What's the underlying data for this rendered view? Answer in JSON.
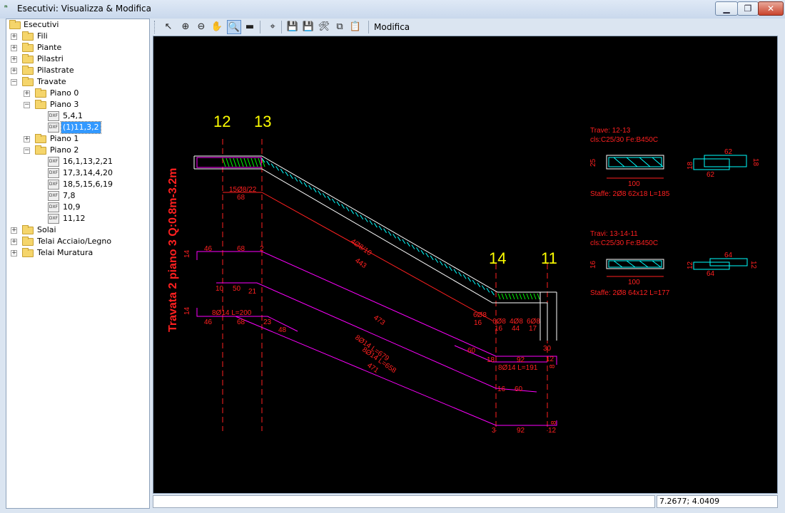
{
  "window": {
    "title": "Esecutivi: Visualizza & Modifica",
    "minimize": "▁",
    "maximize": "❐",
    "close": "✕"
  },
  "tree": {
    "root": "Esecutivi",
    "nodes": [
      {
        "label": "Fili",
        "depth": 1,
        "expander": "+",
        "type": "folder"
      },
      {
        "label": "Piante",
        "depth": 1,
        "expander": "+",
        "type": "folder"
      },
      {
        "label": "Pilastri",
        "depth": 1,
        "expander": "+",
        "type": "folder"
      },
      {
        "label": "Pilastrate",
        "depth": 1,
        "expander": "+",
        "type": "folder"
      },
      {
        "label": "Travate",
        "depth": 1,
        "expander": "−",
        "type": "folder"
      },
      {
        "label": "Piano 0",
        "depth": 2,
        "expander": "+",
        "type": "folder"
      },
      {
        "label": "Piano 3",
        "depth": 2,
        "expander": "−",
        "type": "folder"
      },
      {
        "label": "5,4,1",
        "depth": 3,
        "expander": "",
        "type": "dxf"
      },
      {
        "label": "(1)11,3,2",
        "depth": 3,
        "expander": "",
        "type": "dxf",
        "selected": true
      },
      {
        "label": "Piano 1",
        "depth": 2,
        "expander": "+",
        "type": "folder"
      },
      {
        "label": "Piano 2",
        "depth": 2,
        "expander": "−",
        "type": "folder"
      },
      {
        "label": "16,1,13,2,21",
        "depth": 3,
        "expander": "",
        "type": "dxf"
      },
      {
        "label": "17,3,14,4,20",
        "depth": 3,
        "expander": "",
        "type": "dxf"
      },
      {
        "label": "18,5,15,6,19",
        "depth": 3,
        "expander": "",
        "type": "dxf"
      },
      {
        "label": "7,8",
        "depth": 3,
        "expander": "",
        "type": "dxf"
      },
      {
        "label": "10,9",
        "depth": 3,
        "expander": "",
        "type": "dxf"
      },
      {
        "label": "11,12",
        "depth": 3,
        "expander": "",
        "type": "dxf"
      },
      {
        "label": "Solai",
        "depth": 1,
        "expander": "+",
        "type": "folder"
      },
      {
        "label": "Telai Acciaio/Legno",
        "depth": 1,
        "expander": "+",
        "type": "folder"
      },
      {
        "label": "Telai Muratura",
        "depth": 1,
        "expander": "+",
        "type": "folder"
      }
    ],
    "dxf_icon_text": "DXF"
  },
  "toolbar": {
    "buttons": [
      {
        "name": "select-pointer-button",
        "glyph": "↖"
      },
      {
        "name": "zoom-in-button",
        "glyph": "⊕"
      },
      {
        "name": "zoom-out-button",
        "glyph": "⊖"
      },
      {
        "name": "pan-hand-button",
        "glyph": "✋"
      },
      {
        "name": "zoom-window-button",
        "glyph": "🔍",
        "active": true
      },
      {
        "name": "measure-ruler-button",
        "glyph": "▬"
      },
      {
        "name": "zoom-extents-button",
        "glyph": "⌖"
      },
      {
        "name": "save-button",
        "glyph": "💾"
      },
      {
        "name": "save-as-button",
        "glyph": "💾"
      },
      {
        "name": "settings-tools-button",
        "glyph": "🛠"
      },
      {
        "name": "copy-button",
        "glyph": "⧉"
      },
      {
        "name": "paste-button",
        "glyph": "📋"
      }
    ],
    "modifica_label": "Modifica"
  },
  "drawing": {
    "colors": {
      "background": "#000000",
      "axis_labels": "#ffff00",
      "rebar": "#ff00ff",
      "dimensions": "#ff2020",
      "beam_outline": "#ffffff",
      "hatch": "#00ffff",
      "green": "#00ff00"
    },
    "axis_labels": [
      "12",
      "13",
      "14",
      "11"
    ],
    "vertical_title": "Travata 2 piano 3 Q:0.8m-3.2m",
    "dimension_texts": [
      "15Ø8/22",
      "68",
      "4Ø8/10",
      "443",
      "46",
      "68",
      "2",
      "14",
      "10",
      "50",
      "21",
      "8Ø14  L=200",
      "14",
      "46",
      "68",
      "23",
      "48",
      "473",
      "8Ø14  L=679",
      "8Ø14  L=658",
      "471",
      "6Ø8",
      "4Ø8",
      "6Ø8",
      "16",
      "44",
      "17",
      "30",
      "12",
      "60",
      "18",
      "92",
      "8Ø14  L=191",
      "8",
      "16",
      "60",
      "3",
      "92",
      "12",
      "8",
      "6Ø8",
      "16"
    ],
    "section_1": {
      "title": "Trave: 12-13",
      "material": "cls:C25/30 Fe:B450C",
      "height": "25",
      "width": "100",
      "stirrup_dims": [
        "62",
        "18",
        "62",
        "18"
      ],
      "stirrups": "Staffe:    2Ø8  62x18 L=185"
    },
    "section_2": {
      "title": "Travi: 13-14-11",
      "material": "cls:C25/30 Fe:B450C",
      "height": "16",
      "width": "100",
      "stirrup_dims": [
        "64",
        "12",
        "64",
        "12"
      ],
      "stirrups": "Staffe:    2Ø8  64x12 L=177"
    }
  },
  "status": {
    "message": "",
    "coordinates": "7.2677; 4.0409"
  }
}
